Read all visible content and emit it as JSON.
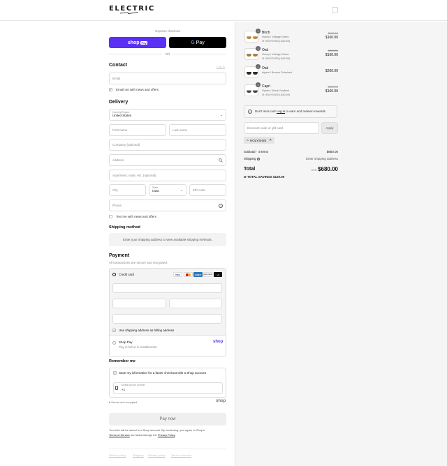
{
  "brand": {
    "name": "ELECTRIC"
  },
  "express": {
    "label": "Express checkout",
    "shop_pay_label": "shop",
    "shop_pay_badge": "Pay",
    "gpay_label": "Pay",
    "or": "OR"
  },
  "contact": {
    "heading": "Contact",
    "login": "Log in",
    "email_placeholder": "Email",
    "newsletter_label": "Email me with news and offers"
  },
  "delivery": {
    "heading": "Delivery",
    "country_label": "Country/Region",
    "country_value": "United States",
    "first_name": "First name",
    "last_name": "Last name",
    "company": "Company (optional)",
    "address": "Address",
    "apartment": "Apartment, suite, etc. (optional)",
    "city": "City",
    "state_label": "State",
    "state_value": "Iowa",
    "zip": "ZIP code",
    "phone": "Phone",
    "sms_label": "Text me with news and offers"
  },
  "shipping": {
    "heading": "Shipping method",
    "note": "Enter your shipping address to view available shipping methods."
  },
  "payment": {
    "heading": "Payment",
    "subtitle": "All transactions are secure and encrypted.",
    "credit_card": "Credit card",
    "cards": [
      "VISA",
      "MC",
      "AMEX",
      "DISCOVER",
      "+4"
    ],
    "billing_same": "Use shipping address as billing address",
    "shop_pay": "Shop Pay",
    "shop_pay_sub": "Pay in full or in installments",
    "shop_pay_logo": "shop"
  },
  "remember": {
    "heading": "Remember me",
    "save_label": "Save my information for a faster checkout with a Shop account",
    "mobile_label": "Mobile phone number",
    "mobile_value": "+1",
    "secure": "Secure and encrypted",
    "shop_logo": "shop"
  },
  "pay_button": "Pay now",
  "legal": {
    "text": "Your info will be saved to a Shop account. By continuing, you agree to Shop's",
    "terms": "Terms of Service",
    "and": "and acknowledge the",
    "privacy": "Privacy Policy",
    "end": "."
  },
  "footer": [
    "Refund policy",
    "Shipping",
    "Privacy policy",
    "Terms of service"
  ],
  "items": [
    {
      "qty": "1",
      "name": "Birch",
      "variant": "Honey / Vintage Green",
      "discount": "HOLYSH20 (-$40.00)",
      "old": "$200.00",
      "price": "$160.00",
      "lens": "#b98a3e",
      "frame": "#c9a26b"
    },
    {
      "qty": "1",
      "name": "Oak",
      "variant": "Honey / Vintage Green",
      "discount": "HOLYSH20 (-$40.00)",
      "old": "$200.00",
      "price": "$160.00",
      "lens": "#9b7a3a",
      "frame": "#c39a62"
    },
    {
      "qty": "1",
      "name": "Oak",
      "variant": "Agave / Bronze Polarized",
      "discount": "",
      "old": "",
      "price": "$200.00",
      "lens": "#3a2a20",
      "frame": "#2a2320"
    },
    {
      "qty": "1",
      "name": "Capri",
      "variant": "Oyster / Black Gradient",
      "discount": "HOLYSH20 (-$40.00)",
      "old": "$200.00",
      "price": "$160.00",
      "lens": "#444",
      "frame": "#b8b0a4"
    }
  ],
  "rewards": {
    "pre": "Don't miss out!",
    "link": "Log in",
    "post": "to earn and redeem rewards"
  },
  "discount": {
    "placeholder": "Discount code or gift card",
    "apply": "Apply",
    "code": "HOLYSH20"
  },
  "summary": {
    "subtotal_label": "Subtotal · 4 items",
    "subtotal": "$680.00",
    "shipping_label": "Shipping",
    "shipping_value": "Enter shipping address",
    "total_label": "Total",
    "currency": "USD",
    "total": "$680.00",
    "savings_label": "TOTAL SAVINGS",
    "savings": "$120.00"
  },
  "colors": {
    "shop_pay": "#5a31f4",
    "gpay": "#000000",
    "link": "#1a1a1a",
    "shop_logo": "#5a31f4"
  }
}
